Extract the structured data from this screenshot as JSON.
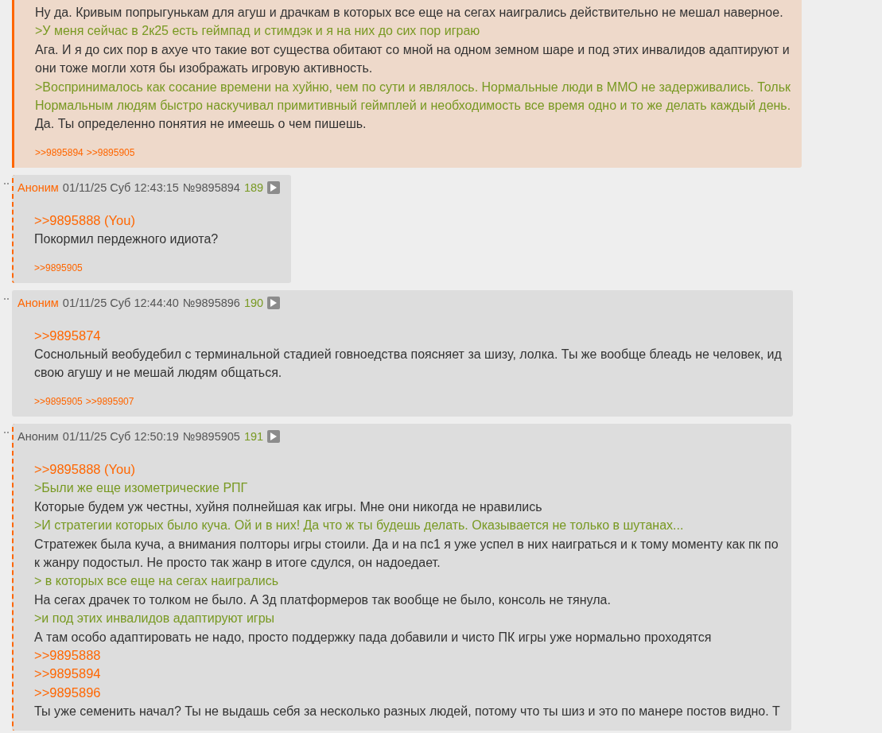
{
  "posts": [
    {
      "highlighted": true,
      "replies_to_you": false,
      "lines": [
        {
          "kind": "text",
          "text": "Ну да. Кривым попрыгунькам для агуш и драчкам в которых все еще на сегах наигрались действительно не мешал наверное."
        },
        {
          "kind": "quote",
          "text": ">У меня сейчас в 2к25 есть геймпад и стимдэк и я на них до сих пор играю"
        },
        {
          "kind": "text",
          "text": "Ага. И я до сих пор в ахуе что такие вот существа обитают со мной на одном земном шаре и под этих инвалидов адаптируют и"
        },
        {
          "kind": "text",
          "text": "они тоже могли хотя бы изображать игровую активность."
        },
        {
          "kind": "quote",
          "text": ">Воспринималось как сосание времени на хуйню, чем по сути и являлось. Нормальные люди в ММО не задерживались. Тольк"
        },
        {
          "kind": "quote",
          "text": "Нормальным людям быстро наскучивал примитивный геймплей и необходимость все время одно и то же делать каждый день."
        },
        {
          "kind": "text",
          "text": "Да. Ты определенно понятия не имеешь о чем пишешь."
        }
      ],
      "replies": [
        ">>9895894",
        ">>9895905"
      ]
    },
    {
      "highlighted": false,
      "replies_to_you": true,
      "author": {
        "text": "Аноним",
        "color": "#ff6600"
      },
      "date": "01/11/25 Суб 12:43:15",
      "number": "№9895894",
      "count": "189",
      "lines": [
        {
          "kind": "reply",
          "text": ">>9895888 (You)"
        },
        {
          "kind": "text",
          "text": "Покормил пердежного идиота?"
        }
      ],
      "replies": [
        ">>9895905"
      ]
    },
    {
      "highlighted": false,
      "replies_to_you": false,
      "author": {
        "text": "Аноним",
        "color": "#ff6600"
      },
      "date": "01/11/25 Суб 12:44:40",
      "number": "№9895896",
      "count": "190",
      "lines": [
        {
          "kind": "reply",
          "text": ">>9895874"
        },
        {
          "kind": "text",
          "text": "Соснольный веобудебил с терминальной стадией говноедства поясняет за шизу, лолка. Ты же вообще блеадь не человек, ид"
        },
        {
          "kind": "text",
          "text": "свою агушу и не мешай людям общаться."
        }
      ],
      "replies": [
        ">>9895905",
        ">>9895907"
      ]
    },
    {
      "highlighted": false,
      "replies_to_you": true,
      "author": {
        "text": "Аноним",
        "color": "#555555"
      },
      "date": "01/11/25 Суб 12:50:19",
      "number": "№9895905",
      "count": "191",
      "lines": [
        {
          "kind": "reply",
          "text": ">>9895888 (You)"
        },
        {
          "kind": "quote",
          "text": ">Были же еще изометрические РПГ"
        },
        {
          "kind": "text",
          "text": "Которые будем уж честны, хуйня полнейшая как игры. Мне они никогда не нравились"
        },
        {
          "kind": "quote",
          "text": ">И стратегии которых было куча. Ой и в них! Да что ж ты будешь делать. Оказывается не только в шутанах..."
        },
        {
          "kind": "text",
          "text": "Стратежек была куча, а внимания полторы игры стоили. Да и на пс1 я уже успел в них наиграться и к тому моменту как пк по"
        },
        {
          "kind": "text",
          "text": "к жанру подостыл. Не просто так жанр в итоге сдулся, он надоедает."
        },
        {
          "kind": "quote",
          "text": "> в которых все еще на сегах наигрались"
        },
        {
          "kind": "text",
          "text": "На сегах драчек то толком не было. А 3д платформеров так вообще не было, консоль не тянула."
        },
        {
          "kind": "quote",
          "text": ">и под этих инвалидов адаптируют игры"
        },
        {
          "kind": "text",
          "text": "А там особо адаптировать не надо, просто поддержку пада добавили и чисто ПК игры уже нормально проходятся"
        },
        {
          "kind": "reply",
          "text": ">>9895888"
        },
        {
          "kind": "reply",
          "text": ">>9895894"
        },
        {
          "kind": "reply",
          "text": ">>9895896"
        },
        {
          "kind": "text",
          "text": "Ты уже семенить начал? Ты не выдашь себя за несколько разных людей, потому что ты шиз и это по манере постов видно. Т"
        }
      ]
    }
  ]
}
